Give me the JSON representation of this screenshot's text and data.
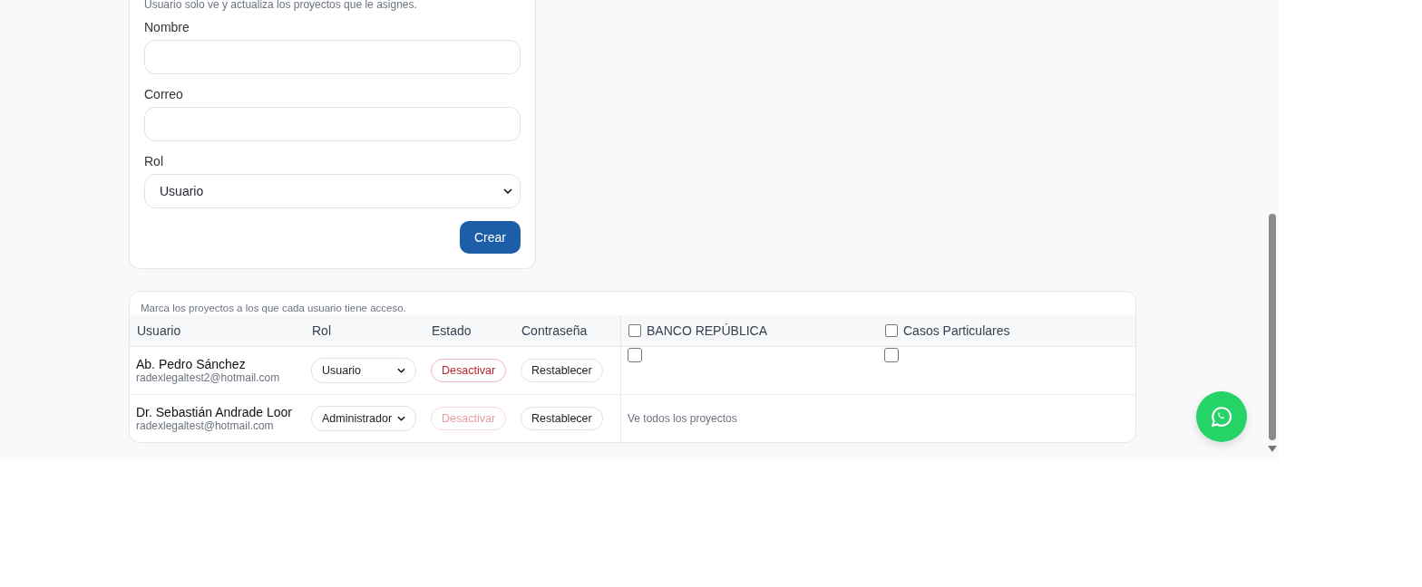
{
  "create_form": {
    "hint": "Usuario solo ve y actualiza los proyectos que le asignes.",
    "fields": [
      {
        "label": "Nombre",
        "kind": "text"
      },
      {
        "label": "Correo",
        "kind": "text"
      },
      {
        "label": "Rol",
        "kind": "select",
        "value": "Usuario"
      }
    ],
    "submit": "Crear"
  },
  "access_table": {
    "hint": "Marca los proyectos a los que cada usuario tiene acceso.",
    "columns": [
      "Usuario",
      "Rol",
      "Estado",
      "Contraseña"
    ],
    "projects": [
      {
        "name": "BANCO REPÚBLICA",
        "checked": false
      },
      {
        "name": "Casos Particulares",
        "checked": false
      }
    ],
    "rows": [
      {
        "name": "Ab. Pedro Sánchez",
        "email": "radexlegaltest2@hotmail.com",
        "role": "Usuario",
        "status_action": "Desactivar",
        "status_disabled": false,
        "password_action": "Restablecer",
        "kind": "projects",
        "access": [
          false,
          false
        ]
      },
      {
        "name": "Dr. Sebastián Andrade Loor",
        "email": "radexlegaltest@hotmail.com",
        "role": "Administrador",
        "status_action": "Desactivar",
        "status_disabled": true,
        "password_action": "Restablecer",
        "kind": "all",
        "all_note": "Ve todos los proyectos"
      }
    ]
  }
}
